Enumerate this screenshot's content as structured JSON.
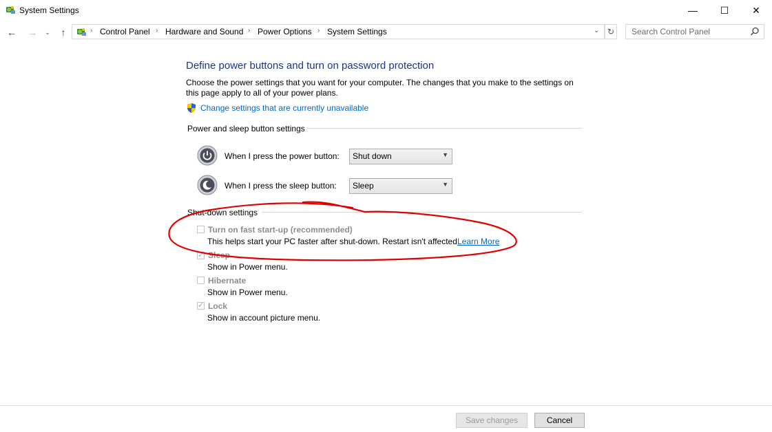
{
  "window": {
    "title": "System Settings",
    "minimize_glyph": "—",
    "maximize_glyph": "☐",
    "close_glyph": "✕"
  },
  "nav": {
    "back_glyph": "←",
    "forward_glyph": "→",
    "recent_glyph": "⌄",
    "up_glyph": "↑",
    "refresh_glyph": "↻",
    "dropdown_glyph": "⌄",
    "breadcrumb_separator": "›",
    "breadcrumbs": [
      "Control Panel",
      "Hardware and Sound",
      "Power Options",
      "System Settings"
    ],
    "search_placeholder": "Search Control Panel"
  },
  "content": {
    "heading": "Define power buttons and turn on password protection",
    "description": "Choose the power settings that you want for your computer. The changes that you make to the settings on this page apply to all of your power plans.",
    "change_settings_link": "Change settings that are currently unavailable",
    "power_section": {
      "label": "Power and sleep button settings",
      "power_button_label": "When I press the power button:",
      "power_button_value": "Shut down",
      "sleep_button_label": "When I press the sleep button:",
      "sleep_button_value": "Sleep"
    },
    "shutdown_section": {
      "label": "Shut-down settings",
      "options": [
        {
          "title": "Turn on fast start-up (recommended)",
          "description": "This helps start your PC faster after shut-down. Restart isn't affected.",
          "checked": false
        },
        {
          "title": "Sleep",
          "description": "Show in Power menu.",
          "checked": true
        },
        {
          "title": "Hibernate",
          "description": "Show in Power menu.",
          "checked": false
        },
        {
          "title": "Lock",
          "description": "Show in account picture menu.",
          "checked": true
        }
      ],
      "learn_more": "Learn More"
    }
  },
  "footer": {
    "save_label": "Save changes",
    "cancel_label": "Cancel"
  },
  "icons": {
    "app": "control-panel-icon",
    "search": "search-icon",
    "shield": "uac-shield-icon",
    "power": "power-button-icon",
    "sleep": "sleep-button-icon"
  },
  "colors": {
    "heading": "#1e3287",
    "link": "#0066cc",
    "annotation": "#e00000"
  }
}
